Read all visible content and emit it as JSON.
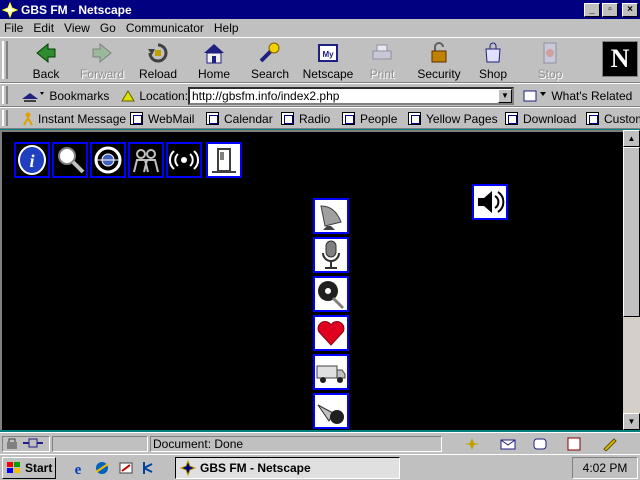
{
  "window": {
    "title": "GBS FM - Netscape",
    "buttons": {
      "minimize": "_",
      "maximize": "▫",
      "close": "×"
    }
  },
  "menu": [
    "File",
    "Edit",
    "View",
    "Go",
    "Communicator",
    "Help"
  ],
  "toolbar": {
    "buttons": [
      {
        "label": "Back",
        "icon": "back-arrow-icon",
        "enabled": true
      },
      {
        "label": "Forward",
        "icon": "forward-arrow-icon",
        "enabled": false
      },
      {
        "label": "Reload",
        "icon": "reload-icon",
        "enabled": true
      },
      {
        "label": "Home",
        "icon": "home-icon",
        "enabled": true
      },
      {
        "label": "Search",
        "icon": "search-icon",
        "enabled": true
      },
      {
        "label": "Netscape",
        "icon": "my-netscape-icon",
        "enabled": true
      },
      {
        "label": "Print",
        "icon": "print-icon",
        "enabled": false
      },
      {
        "label": "Security",
        "icon": "padlock-icon",
        "enabled": true
      },
      {
        "label": "Shop",
        "icon": "shop-icon",
        "enabled": true
      },
      {
        "label": "Stop",
        "icon": "stop-icon",
        "enabled": false
      }
    ],
    "logo": "N"
  },
  "location": {
    "bookmarks_label": "Bookmarks",
    "location_label": "Location:",
    "url": "http://gbsfm.info/index2.php",
    "whats_related": "What's Related"
  },
  "personal_toolbar": [
    "Instant Message",
    "WebMail",
    "Calendar",
    "Radio",
    "People",
    "Yellow Pages",
    "Download",
    "Customize"
  ],
  "content": {
    "top_icons": [
      "info-icon",
      "magnifier-icon",
      "globe-icon",
      "people-icon",
      "broadcast-icon",
      "door-icon"
    ],
    "side_icon": "speaker-icon",
    "column_icons": [
      "satellite-dish-icon",
      "microphone-icon",
      "record-icon",
      "heart-icon",
      "truck-icon",
      "megaphone-icon"
    ]
  },
  "status": {
    "text": "Document: Done"
  },
  "taskbar": {
    "start": "Start",
    "task": "GBS FM - Netscape",
    "clock": "4:02 PM"
  }
}
